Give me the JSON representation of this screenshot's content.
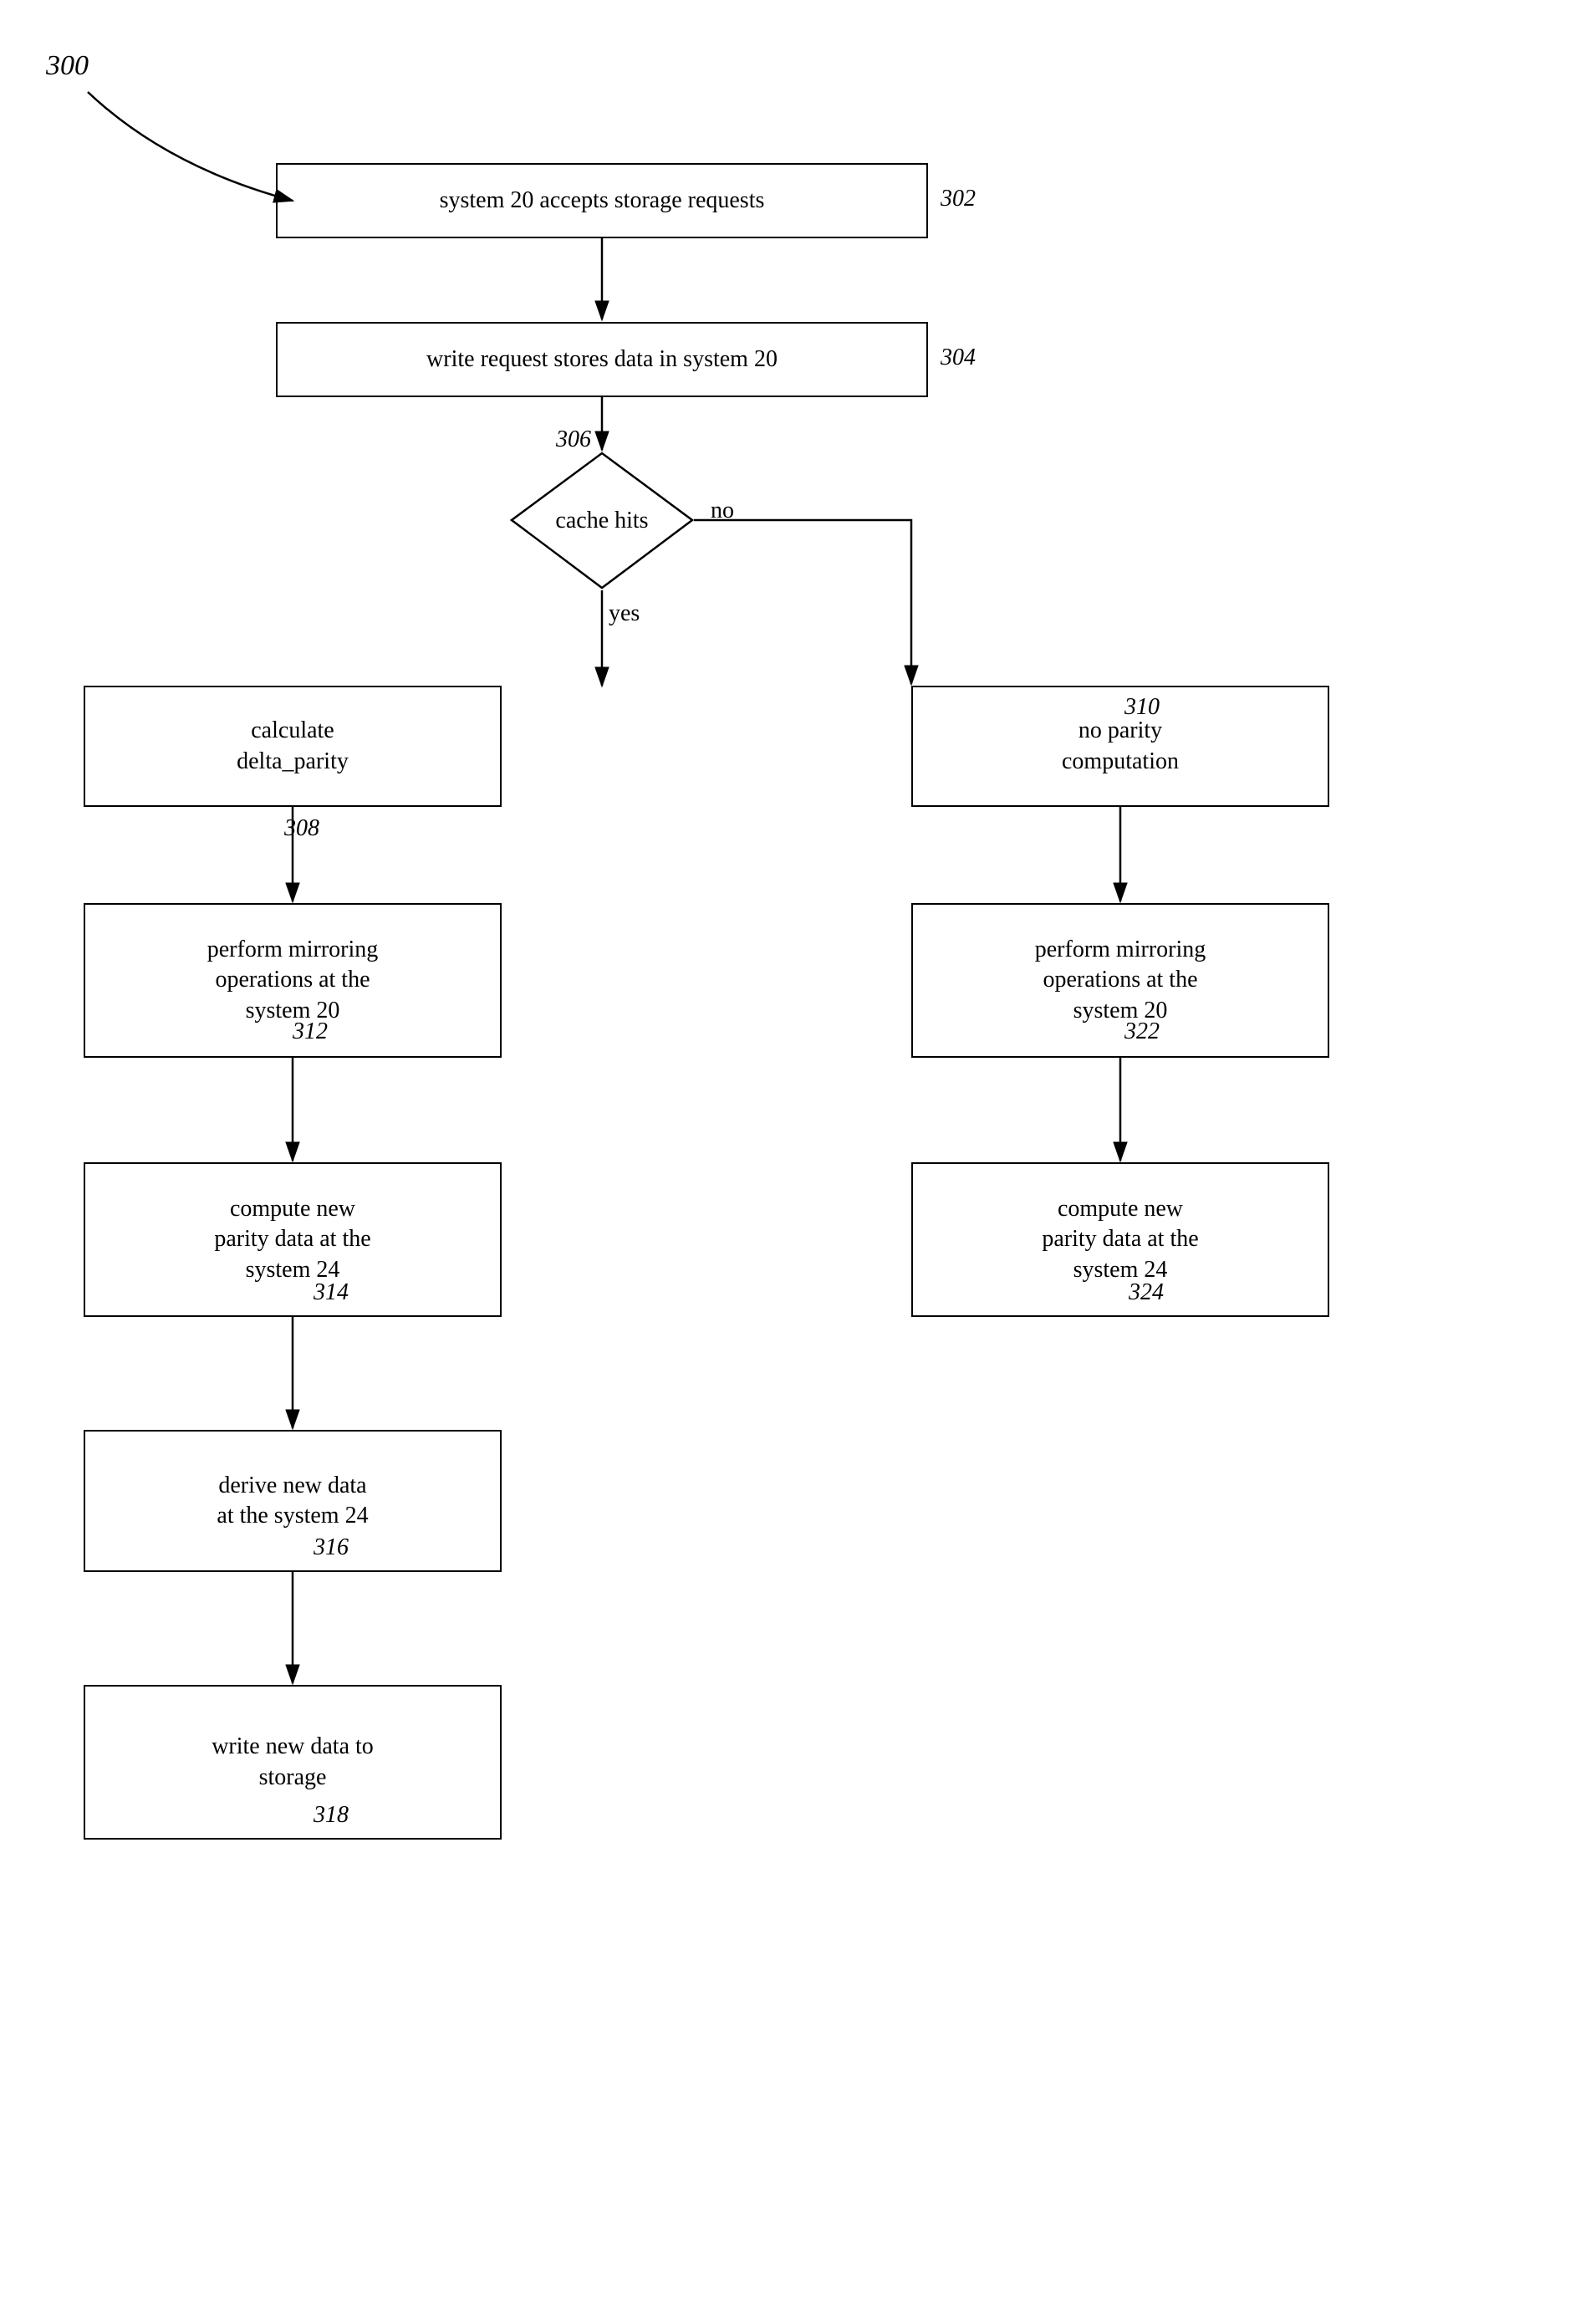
{
  "diagram": {
    "title": "300",
    "nodes": {
      "box302": {
        "label": "system 20 accepts storage requests",
        "ref": "302"
      },
      "box304": {
        "label": "write request stores data in system 20",
        "ref": "304"
      },
      "diamond306": {
        "label": "cache hits",
        "ref": "306"
      },
      "box308": {
        "label": "calculate\ndelta_parity",
        "ref": "308"
      },
      "box310": {
        "label": "no parity\ncomputation",
        "ref": "310"
      },
      "box312": {
        "label": "perform mirroring\noperations at the\nsystem 20",
        "ref": "312"
      },
      "box322": {
        "label": "perform mirroring\noperations at the\nsystem 20",
        "ref": "322"
      },
      "box314": {
        "label": "compute new\nparity data at the\nsystem 24",
        "ref": "314"
      },
      "box324": {
        "label": "compute new\nparity data at the\nsystem 24",
        "ref": "324"
      },
      "box316": {
        "label": "derive new data\nat the system 24",
        "ref": "316"
      },
      "box318": {
        "label": "write new data to\nstorage",
        "ref": "318"
      }
    },
    "edge_labels": {
      "no": "no",
      "yes": "yes"
    }
  }
}
